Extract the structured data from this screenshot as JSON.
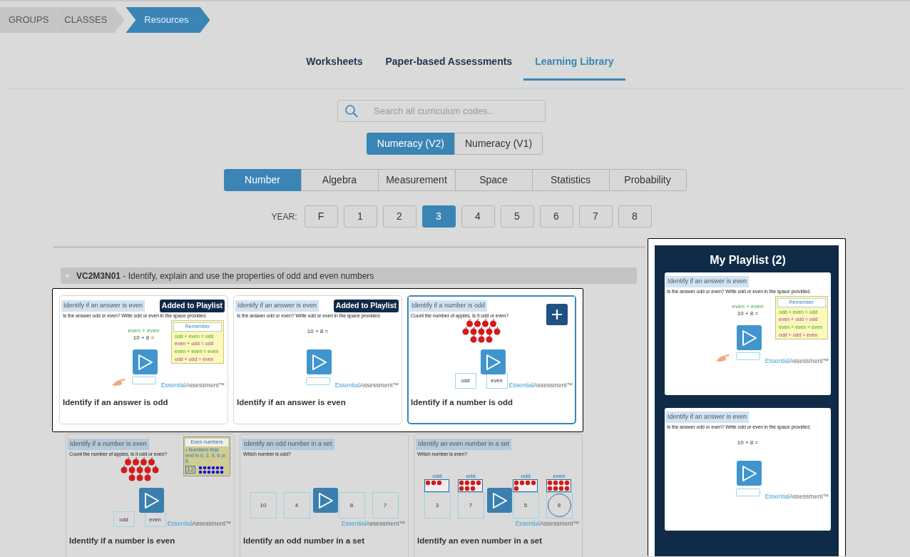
{
  "breadcrumb": [
    {
      "label": "GROUPS",
      "selected": false
    },
    {
      "label": "CLASSES",
      "selected": false
    },
    {
      "label": "Resources",
      "selected": true
    }
  ],
  "tabs": [
    {
      "label": "Worksheets",
      "selected": false
    },
    {
      "label": "Paper-based Assessments",
      "selected": false
    },
    {
      "label": "Learning Library",
      "selected": true
    }
  ],
  "search": {
    "placeholder": "Search all curriculum codes.."
  },
  "versions": [
    {
      "label": "Numeracy (V2)",
      "selected": true
    },
    {
      "label": "Numeracy (V1)",
      "selected": false
    }
  ],
  "strands": [
    {
      "label": "Number",
      "selected": true
    },
    {
      "label": "Algebra",
      "selected": false
    },
    {
      "label": "Measurement",
      "selected": false
    },
    {
      "label": "Space",
      "selected": false
    },
    {
      "label": "Statistics",
      "selected": false
    },
    {
      "label": "Probability",
      "selected": false
    }
  ],
  "year": {
    "label": "YEAR:",
    "options": [
      {
        "label": "F",
        "selected": false
      },
      {
        "label": "1",
        "selected": false
      },
      {
        "label": "2",
        "selected": false
      },
      {
        "label": "3",
        "selected": true
      },
      {
        "label": "4",
        "selected": false
      },
      {
        "label": "5",
        "selected": false
      },
      {
        "label": "6",
        "selected": false
      },
      {
        "label": "7",
        "selected": false
      },
      {
        "label": "8",
        "selected": false
      }
    ]
  },
  "section": {
    "title": "**VC2M3N01** - Identify, explain and use the properties of odd and even numbers"
  },
  "card_rows": [
    {
      "highlighted": true,
      "cards": [
        {
          "title": "Identify if an answer is odd",
          "in_playlist": true,
          "badge": "Added to Playlist",
          "selected": false,
          "thumbnail": {
            "kind": "sum",
            "tag": "Identify if an answer is even",
            "question": "Is the answer odd or even? Write odd or even in the space provided.",
            "labels": "even + even",
            "equation": "10 + 8 =",
            "pointer": true,
            "remember": {
              "title": "Remember",
              "lines": [
                "odd + even = odd",
                "even + odd = odd",
                "even + even = even",
                "odd + odd  = even"
              ]
            },
            "brand": [
              "Essential",
              "Assessment™"
            ]
          }
        },
        {
          "title": "Identify if an answer is even",
          "in_playlist": true,
          "badge": "Added to Playlist",
          "selected": false,
          "thumbnail": {
            "kind": "sum",
            "tag": "Identify if an answer is even",
            "question": "Is the answer odd or even? Write odd or even in the space provided.",
            "equation": "10 + 8 =",
            "pointer": false,
            "brand": [
              "Essential",
              "Assessment™"
            ]
          }
        },
        {
          "title": "Identify if a number is odd",
          "in_playlist": false,
          "selected": true,
          "thumbnail": {
            "kind": "apples",
            "tag": "Identify if a number is odd",
            "question": "Count the number of apples. Is it odd or even?",
            "choices": [
              "odd",
              "even"
            ],
            "brand": [
              "Essential",
              "Assessment™"
            ]
          }
        }
      ]
    },
    {
      "highlighted": false,
      "cards": [
        {
          "title": "Identify if a number is even",
          "in_playlist": false,
          "selected": false,
          "thumbnail": {
            "kind": "apples",
            "tag": "Identify if a number is even",
            "question": "Count the number of apples. Is it odd or even?",
            "choices": [
              "odd",
              "even"
            ],
            "hint": {
              "title": "Even numbers",
              "text": "• Numbers that end in 0, 2, 4, 6 or 8",
              "number": "12"
            },
            "brand": [
              "Essential",
              "Assessment™"
            ]
          }
        },
        {
          "title": "Identify an odd number in a set",
          "in_playlist": false,
          "selected": false,
          "thumbnail": {
            "kind": "set",
            "tag": "Identify an odd number in a set",
            "question": "Which number is odd?",
            "options": [
              {
                "value": "10",
                "circled": false
              },
              {
                "value": "4",
                "circled": false
              },
              {
                "value": "8",
                "circled": false
              },
              {
                "value": "7",
                "circled": false
              }
            ],
            "brand": [
              "Essential",
              "Assessment™"
            ]
          }
        },
        {
          "title": "Identify an even number in a set",
          "in_playlist": false,
          "selected": false,
          "thumbnail": {
            "kind": "set",
            "tag": "Identify an even number in a set",
            "question": "Which number is even?",
            "options": [
              {
                "value": "3",
                "label": "odd",
                "circled": false
              },
              {
                "value": "7",
                "label": "odd",
                "circled": false
              },
              {
                "value": "5",
                "label": "odd",
                "circled": false
              },
              {
                "value": "8",
                "label": "even",
                "circled": true
              }
            ],
            "brand": [
              "Essential",
              "Assessment™"
            ]
          }
        }
      ]
    }
  ],
  "playlist": {
    "title": "My Playlist (2)",
    "highlighted": true,
    "items": [
      {
        "kind": "sum",
        "tag": "Identify if an answer is even",
        "question": "Is the answer odd or even? Write odd or even in the space provided.",
        "labels": "even + even",
        "equation": "10 + 8 =",
        "pointer": true,
        "remember": {
          "title": "Remember",
          "lines": [
            "odd + even = odd",
            "even + odd = odd",
            "even + even = even",
            "odd + odd  = even"
          ]
        },
        "brand": [
          "Essential",
          "Assessment™"
        ]
      },
      {
        "kind": "sum",
        "tag": "Identify if an answer is even",
        "question": "Is the answer odd or even? Write odd or even in the space provided.",
        "equation": "10 + 8 =",
        "pointer": false,
        "brand": [
          "Essential",
          "Assessment™"
        ]
      }
    ]
  }
}
